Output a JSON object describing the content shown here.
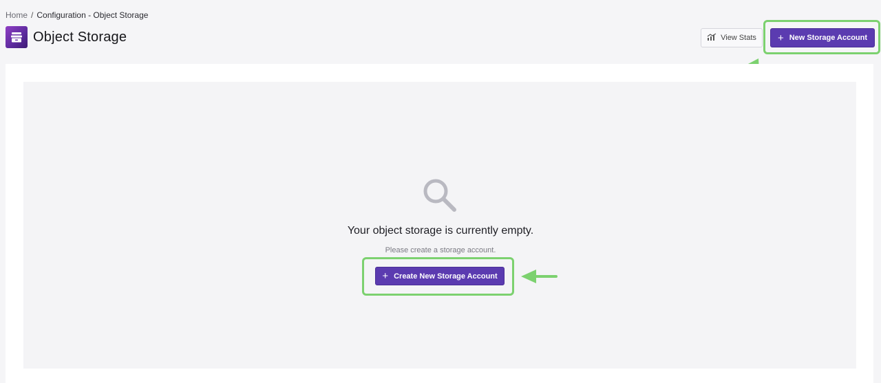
{
  "breadcrumb": {
    "home": "Home",
    "separator": "/",
    "current": "Configuration - Object Storage"
  },
  "header": {
    "title": "Object Storage",
    "icon": "storage-box-icon"
  },
  "toolbar": {
    "view_stats_label": "View Stats",
    "new_account_label": "New Storage Account"
  },
  "empty_state": {
    "icon": "search-icon",
    "title": "Your object storage is currently empty.",
    "subtitle": "Please create a storage account.",
    "button_label": "Create New Storage Account"
  },
  "colors": {
    "primary": "#5b3bb0",
    "highlight": "#7cd16f",
    "background": "#f5f5f7"
  }
}
